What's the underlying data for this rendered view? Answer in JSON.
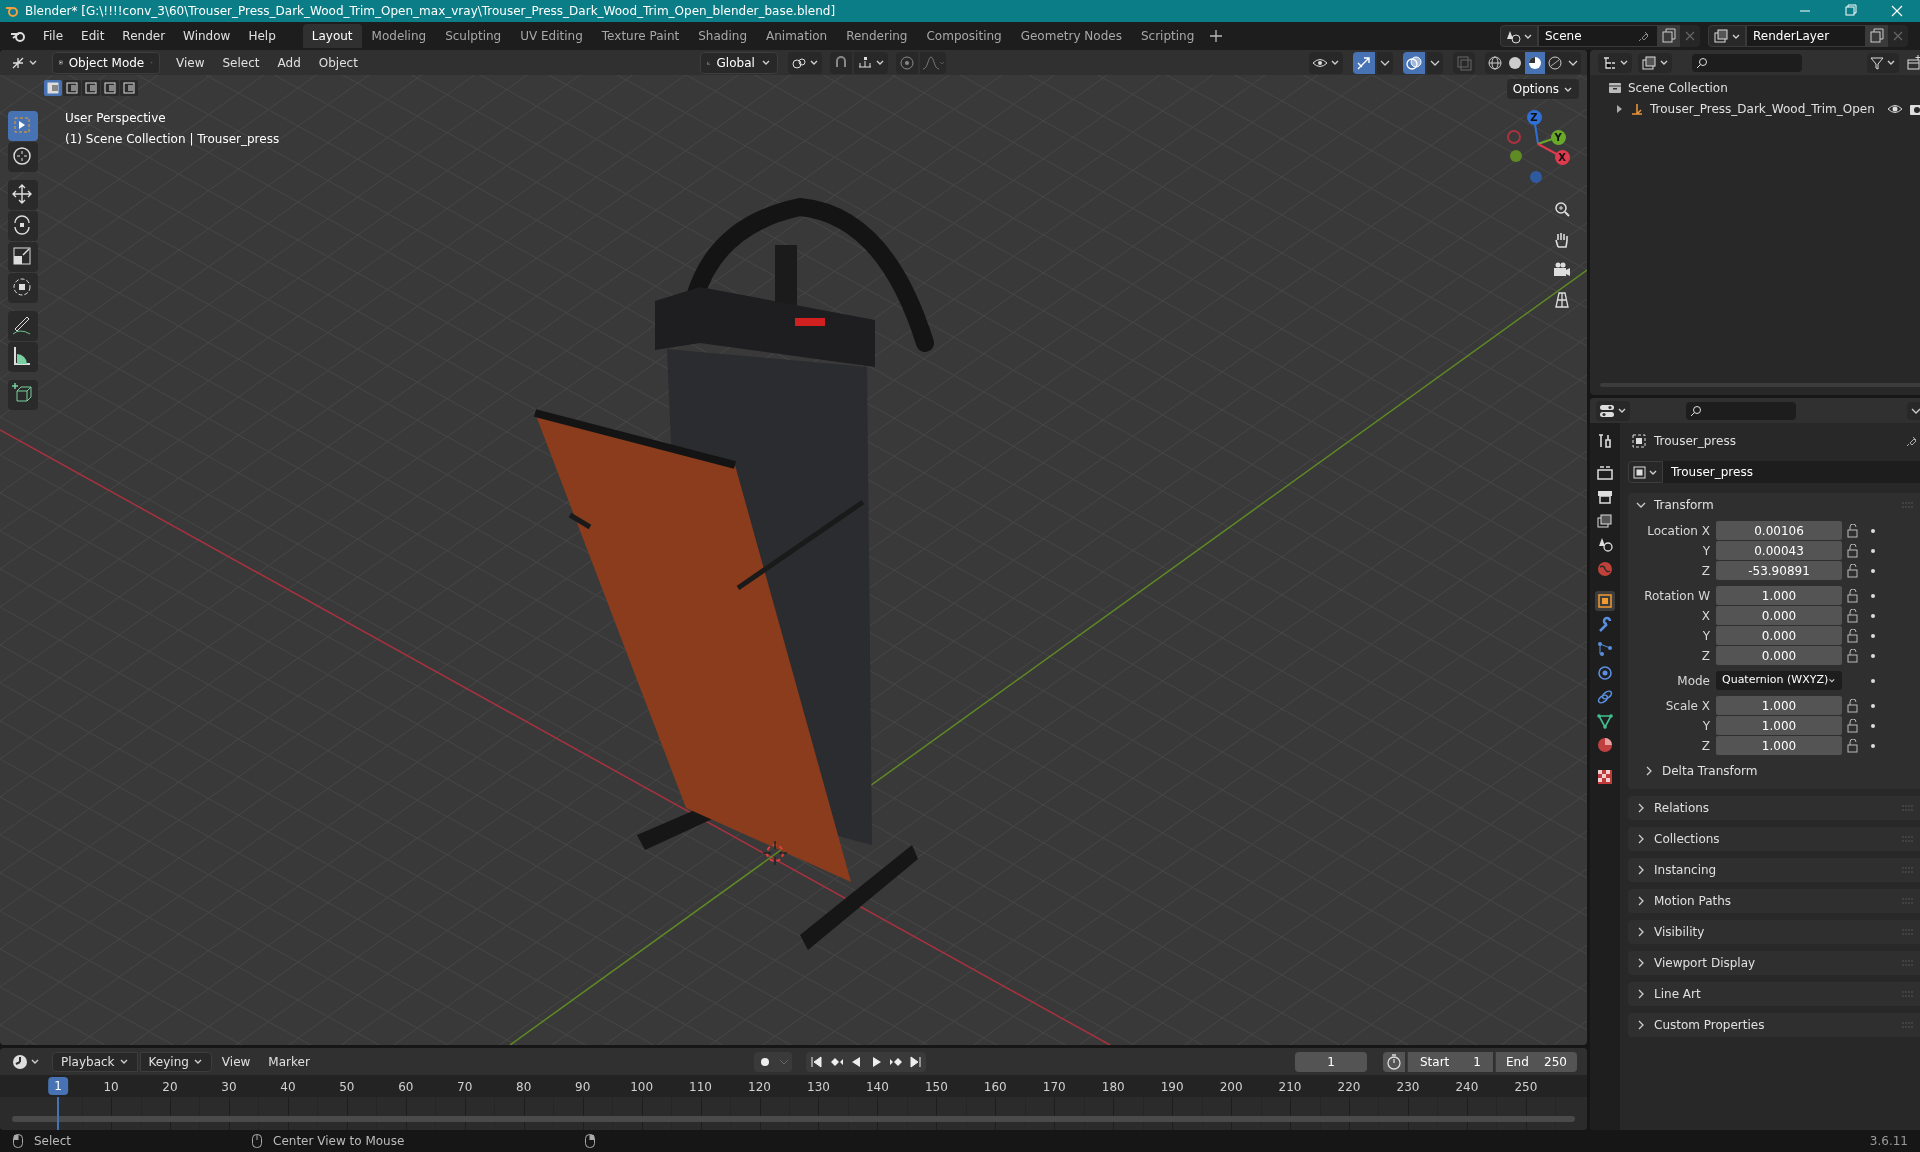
{
  "window": {
    "title": "Blender* [G:\\!!!!conv_3\\60\\Trouser_Press_Dark_Wood_Trim_Open_max_vray\\Trouser_Press_Dark_Wood_Trim_Open_blender_base.blend]"
  },
  "menu": [
    "File",
    "Edit",
    "Render",
    "Window",
    "Help"
  ],
  "workspace_tabs": [
    {
      "label": "Layout",
      "selected": true
    },
    {
      "label": "Modeling",
      "selected": false
    },
    {
      "label": "Sculpting",
      "selected": false
    },
    {
      "label": "UV Editing",
      "selected": false
    },
    {
      "label": "Texture Paint",
      "selected": false
    },
    {
      "label": "Shading",
      "selected": false
    },
    {
      "label": "Animation",
      "selected": false
    },
    {
      "label": "Rendering",
      "selected": false
    },
    {
      "label": "Compositing",
      "selected": false
    },
    {
      "label": "Geometry Nodes",
      "selected": false
    },
    {
      "label": "Scripting",
      "selected": false
    }
  ],
  "scene": {
    "name": "Scene"
  },
  "view_layer": {
    "name": "RenderLayer"
  },
  "viewport_header": {
    "mode": "Object Mode",
    "menus": [
      "View",
      "Select",
      "Add",
      "Object"
    ],
    "orientation": "Global",
    "options": "Options"
  },
  "viewport_overlay": {
    "view_name": "User Perspective",
    "context": "(1) Scene Collection | Trouser_press"
  },
  "tools": [
    {
      "kind": "select",
      "selected": true
    },
    {
      "kind": "cursor",
      "selected": false
    },
    {
      "kind": "move",
      "selected": false
    },
    {
      "kind": "rotate",
      "selected": false
    },
    {
      "kind": "scale",
      "selected": false
    },
    {
      "kind": "transform",
      "selected": false
    },
    {
      "kind": "annotate",
      "selected": false
    },
    {
      "kind": "measure",
      "selected": false
    },
    {
      "kind": "addcube",
      "selected": false
    }
  ],
  "gizmo_axes": [
    {
      "label": "Z",
      "color": "#2f6fd6"
    },
    {
      "label": "Y",
      "color": "#6aa82a"
    },
    {
      "label": "X",
      "color": "#e03a4e"
    }
  ],
  "outliner": {
    "root": "Scene Collection",
    "children": [
      {
        "label": "Trouser_Press_Dark_Wood_Trim_Open",
        "expanded": false
      }
    ]
  },
  "properties": {
    "tabs": [
      {
        "kind": "tool",
        "selected": false
      },
      {
        "kind": "render",
        "selected": false
      },
      {
        "kind": "output",
        "selected": false
      },
      {
        "kind": "viewlayer",
        "selected": false
      },
      {
        "kind": "scene",
        "selected": false
      },
      {
        "kind": "world",
        "selected": false
      },
      {
        "kind": "object",
        "selected": true
      },
      {
        "kind": "modifiers",
        "selected": false
      },
      {
        "kind": "particles",
        "selected": false
      },
      {
        "kind": "physics",
        "selected": false
      },
      {
        "kind": "constraints",
        "selected": false
      },
      {
        "kind": "data",
        "selected": false
      },
      {
        "kind": "material",
        "selected": false
      },
      {
        "kind": "texture",
        "selected": false
      }
    ],
    "object_name": "Trouser_press",
    "name_field": "Trouser_press",
    "transform": {
      "title": "Transform",
      "expanded": true,
      "groups": [
        [
          {
            "kind": "number",
            "label": "Location X",
            "value": "0.00106"
          },
          {
            "kind": "number",
            "label": "Y",
            "value": "0.00043"
          },
          {
            "kind": "number",
            "label": "Z",
            "value": "-53.90891"
          }
        ],
        [
          {
            "kind": "number",
            "label": "Rotation W",
            "value": "1.000"
          },
          {
            "kind": "number",
            "label": "X",
            "value": "0.000"
          },
          {
            "kind": "number",
            "label": "Y",
            "value": "0.000"
          },
          {
            "kind": "number",
            "label": "Z",
            "value": "0.000"
          }
        ],
        [
          {
            "kind": "dropdown",
            "label": "Mode",
            "value": "Quaternion (WXYZ)"
          }
        ],
        [
          {
            "kind": "number",
            "label": "Scale X",
            "value": "1.000"
          },
          {
            "kind": "number",
            "label": "Y",
            "value": "1.000"
          },
          {
            "kind": "number",
            "label": "Z",
            "value": "1.000"
          }
        ]
      ],
      "subpanel": {
        "title": "Delta Transform",
        "expanded": false
      }
    },
    "panels": [
      {
        "title": "Relations",
        "expanded": false
      },
      {
        "title": "Collections",
        "expanded": false
      },
      {
        "title": "Instancing",
        "expanded": false
      },
      {
        "title": "Motion Paths",
        "expanded": false
      },
      {
        "title": "Visibility",
        "expanded": false
      },
      {
        "title": "Viewport Display",
        "expanded": false
      },
      {
        "title": "Line Art",
        "expanded": false
      },
      {
        "title": "Custom Properties",
        "expanded": false
      }
    ]
  },
  "timeline": {
    "menus": [
      "Playback",
      "Keying",
      "View",
      "Marker"
    ],
    "current_frame": "1",
    "start_label": "Start",
    "start": "1",
    "end_label": "End",
    "end": "250",
    "ruler": [
      "1",
      "10",
      "20",
      "30",
      "40",
      "50",
      "60",
      "70",
      "80",
      "90",
      "100",
      "110",
      "120",
      "130",
      "140",
      "150",
      "160",
      "170",
      "180",
      "190",
      "200",
      "210",
      "220",
      "230",
      "240",
      "250"
    ]
  },
  "status_bar": {
    "hints": [
      "Select",
      "Center View to Mouse"
    ],
    "version": "3.6.11"
  }
}
